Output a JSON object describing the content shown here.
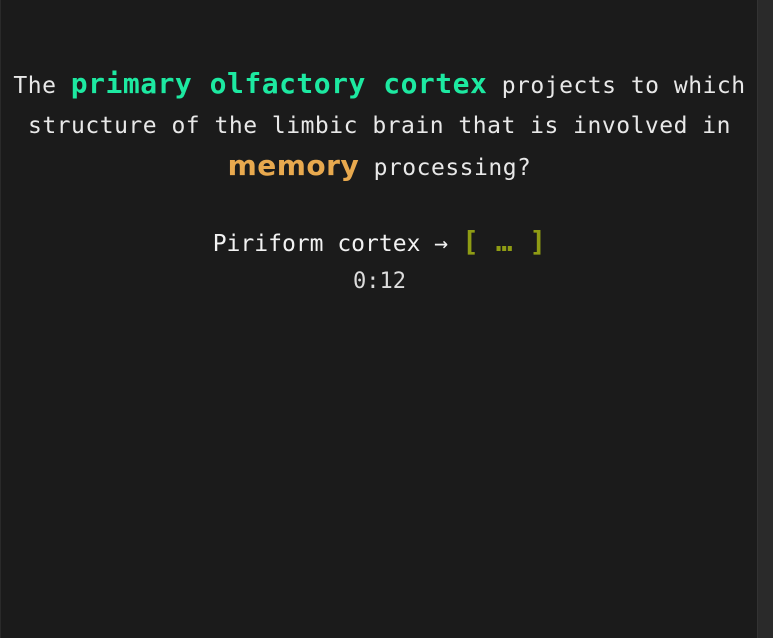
{
  "question": {
    "part1": "The ",
    "highlight1": "primary olfactory cortex",
    "part2": " projects to which structure of the limbic brain that is involved in ",
    "highlight2": "memory",
    "part3": " processing?"
  },
  "answer": {
    "prefix": "Piriform cortex",
    "arrow": "→",
    "blank": "[ … ]"
  },
  "timer": "0:12",
  "colors": {
    "background": "#1b1b1b",
    "keyword": "#1de9a1",
    "emphasis": "#e8a94e",
    "blank": "#8f9c14"
  }
}
